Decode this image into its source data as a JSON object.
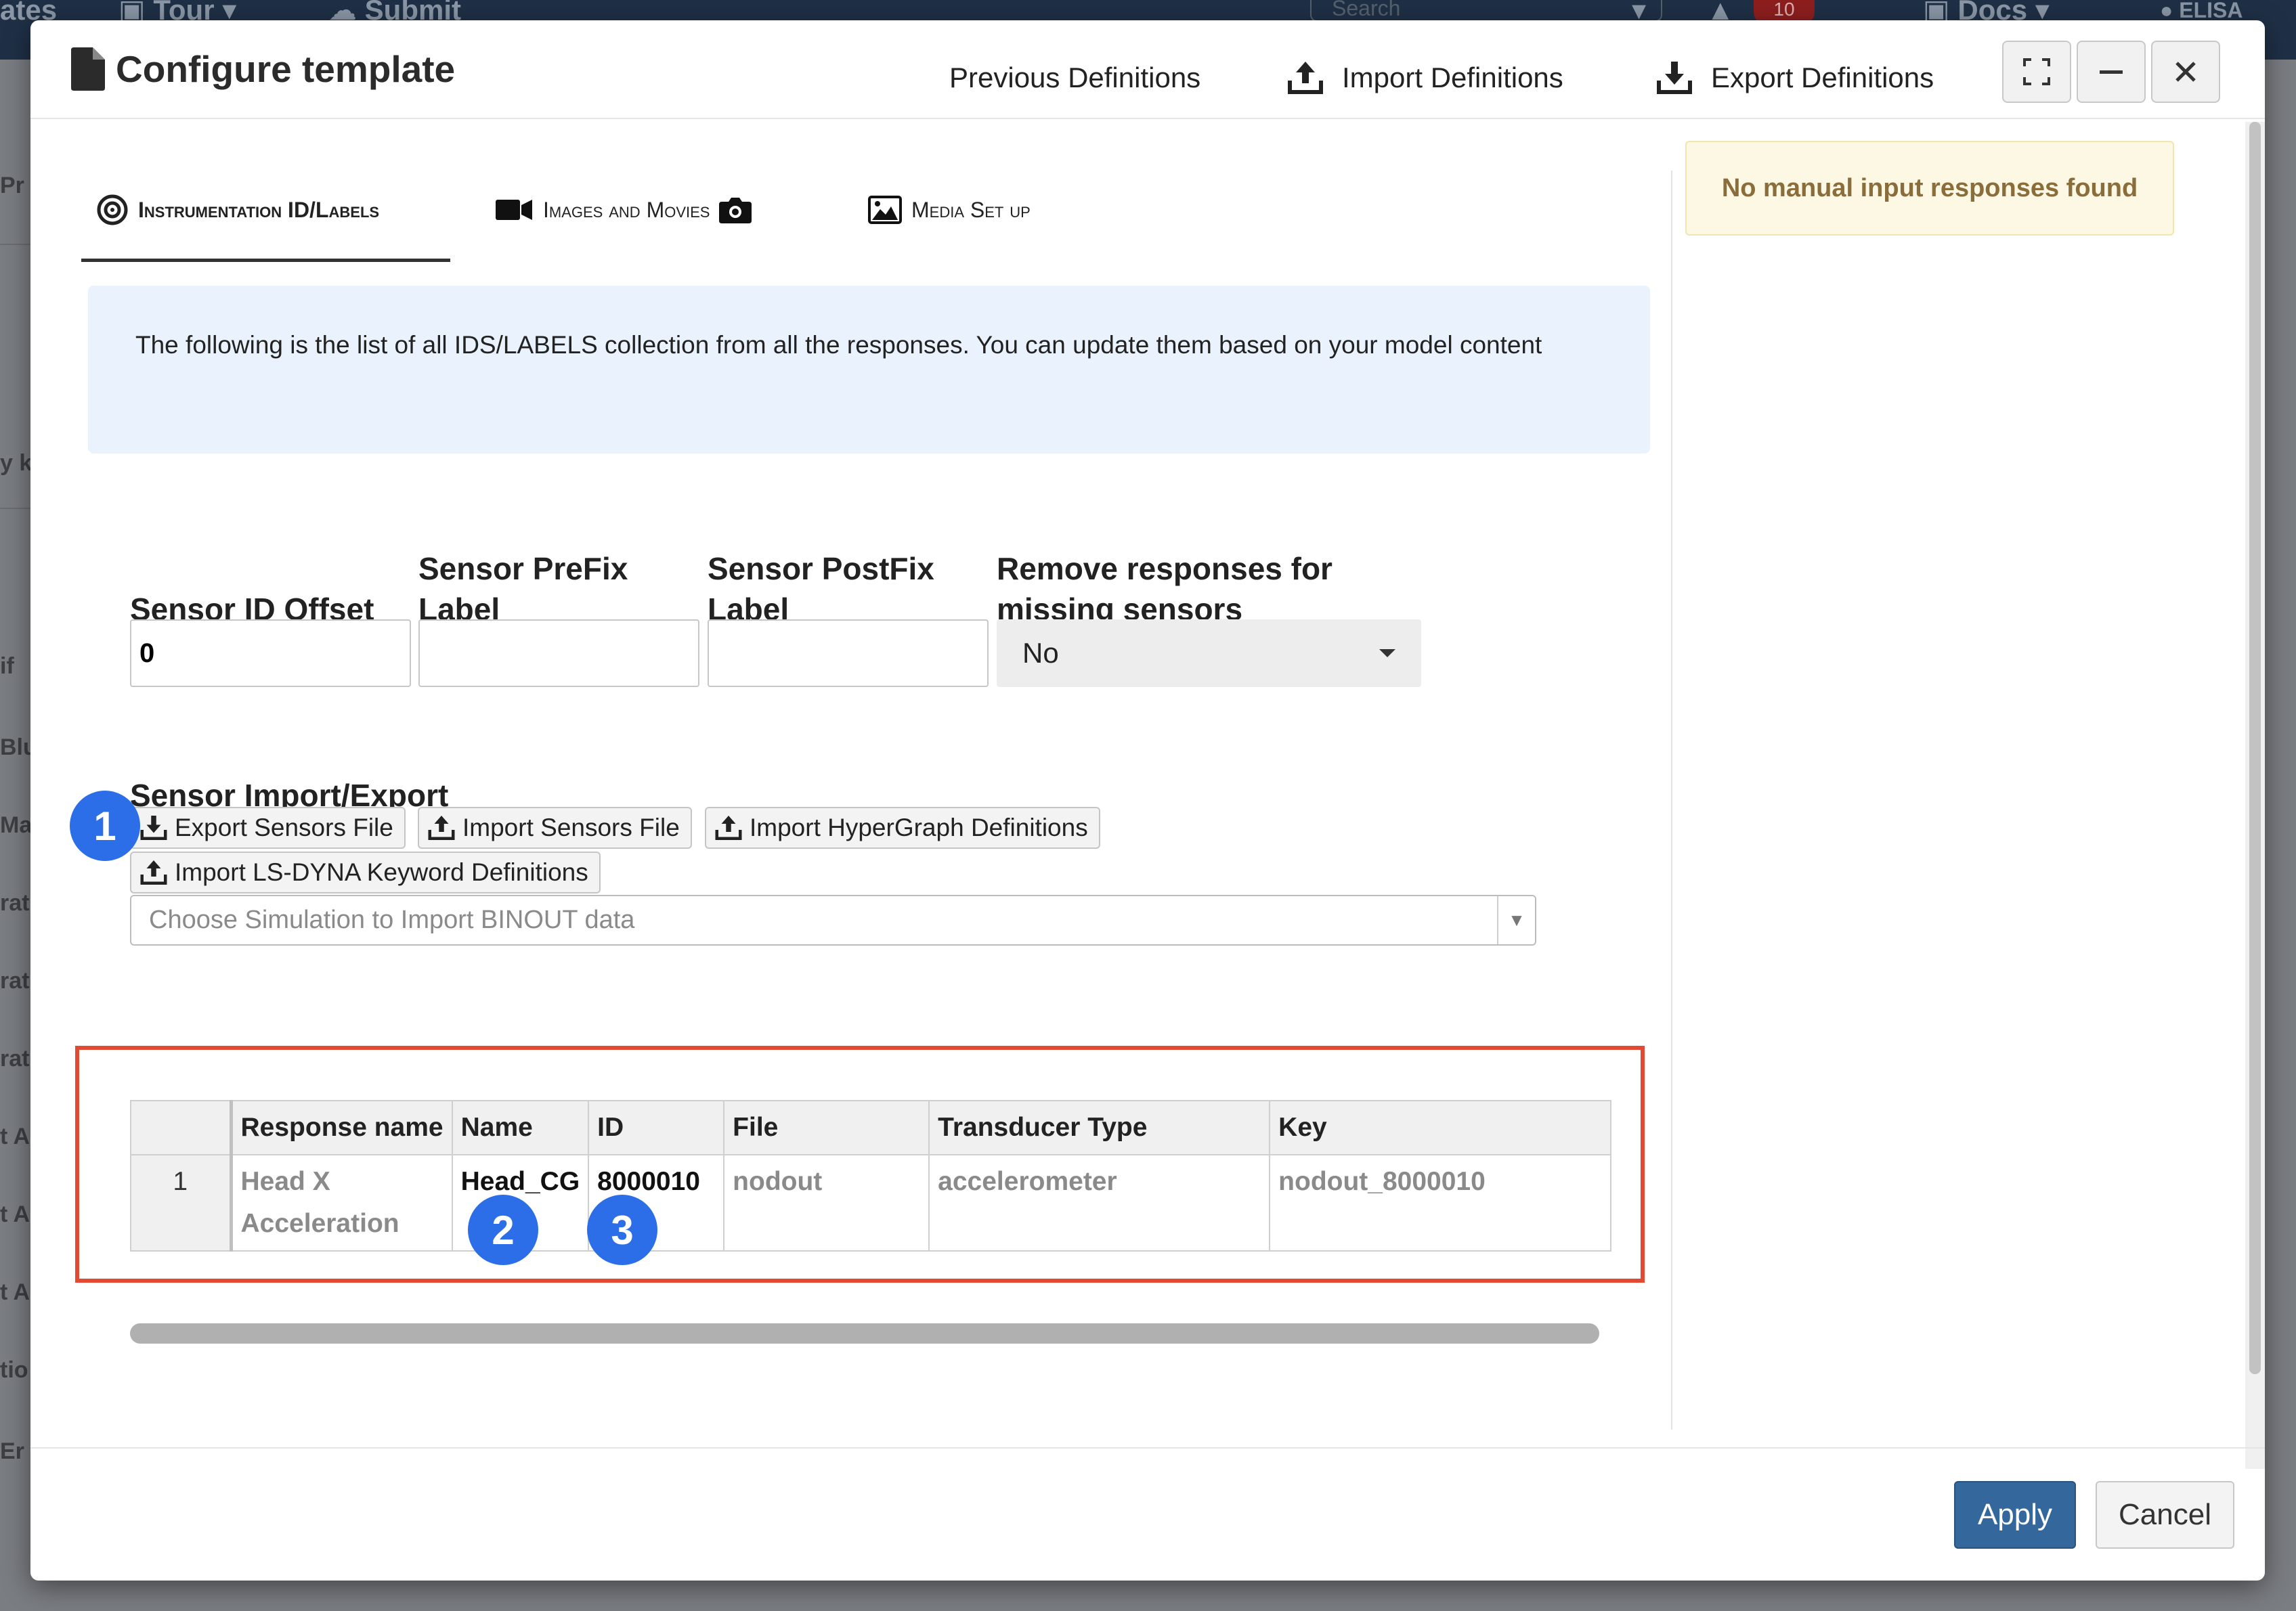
{
  "background": {
    "nav": [
      "ates",
      "Tour",
      "Submit",
      "Search",
      "Docs",
      "ELISA"
    ],
    "notification_count": "10",
    "sidebar_fragments": [
      "Pr",
      "y k",
      "if",
      "Blu",
      "Ma",
      "rat",
      "rat",
      "rat",
      "t A",
      "t A",
      "t A",
      "tio",
      "Er"
    ]
  },
  "modal": {
    "title": "Configure template",
    "header_links": {
      "previous": "Previous Definitions",
      "import": "Import Definitions",
      "export": "Export Definitions"
    },
    "tabs": [
      {
        "label": "Instrumentation ID/Labels",
        "active": true
      },
      {
        "label": "Images and Movies",
        "active": false
      },
      {
        "label": "Media Set up",
        "active": false
      }
    ],
    "info_text": "The following is the list of all IDS/LABELS collection from all the responses. You can update them based on your model content",
    "fields": {
      "offset_label": "Sensor ID Offset",
      "offset_value": "0",
      "prefix_label": "Sensor PreFix Label",
      "prefix_value": "",
      "postfix_label": "Sensor PostFix Label",
      "postfix_value": "",
      "remove_label": "Remove responses for missing sensors",
      "remove_value": "No"
    },
    "import_export": {
      "title": "Sensor Import/Export",
      "buttons": {
        "export_sensors": "Export Sensors File",
        "import_sensors": "Import Sensors File",
        "import_hypergraph": "Import HyperGraph Definitions",
        "import_lsdyna": "Import LS-DYNA Keyword Definitions"
      },
      "binout_placeholder": "Choose Simulation to Import BINOUT data"
    },
    "table": {
      "columns": [
        "Response name",
        "Name",
        "ID",
        "File",
        "Transducer Type",
        "Key"
      ],
      "rows": [
        {
          "num": "1",
          "response_name": "Head X Acceleration",
          "name": "Head_CG",
          "id": "8000010",
          "file": "nodout",
          "transducer_type": "accelerometer",
          "key": "nodout_8000010"
        }
      ]
    },
    "markers": [
      "1",
      "2",
      "3"
    ],
    "side_notice": "No manual input responses found",
    "footer": {
      "apply": "Apply",
      "cancel": "Cancel"
    }
  },
  "colors": {
    "accent": "#2b6ee8",
    "highlight": "#e34a33",
    "apply": "#34689c",
    "info_bg": "#eaf3fd",
    "notice_bg": "#fcf8e3"
  }
}
